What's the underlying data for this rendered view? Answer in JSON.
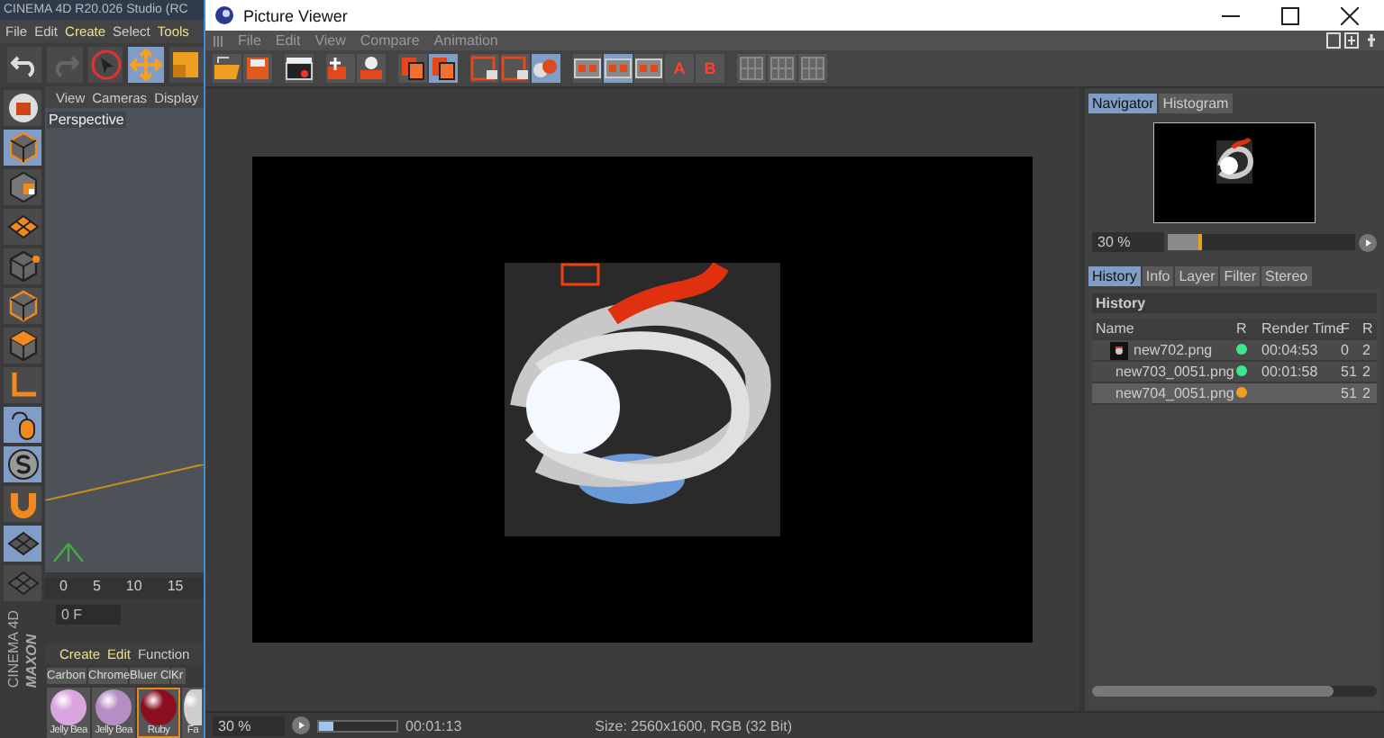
{
  "background_app": {
    "title": "CINEMA 4D R20.026 Studio (RC",
    "menu": [
      {
        "label": "File",
        "accent": false
      },
      {
        "label": "Edit",
        "accent": false
      },
      {
        "label": "Create",
        "accent": true
      },
      {
        "label": "Select",
        "accent": false
      },
      {
        "label": "Tools",
        "accent": true
      }
    ],
    "toolbar": [
      {
        "kind": "undo",
        "active": false
      },
      {
        "kind": "redo",
        "active": false
      },
      {
        "kind": "select",
        "active": false
      },
      {
        "kind": "move",
        "active": true
      },
      {
        "kind": "scale",
        "active": false
      }
    ],
    "tool_column": [
      {
        "kind": "render",
        "active": false
      },
      {
        "kind": "cube",
        "active": true
      },
      {
        "kind": "checker",
        "active": false
      },
      {
        "kind": "grid",
        "active": false
      },
      {
        "kind": "point",
        "active": false
      },
      {
        "kind": "edge",
        "active": false
      },
      {
        "kind": "face",
        "active": false
      },
      {
        "kind": "axis",
        "active": false
      },
      {
        "kind": "mouse",
        "active": true
      },
      {
        "kind": "snap",
        "active": true
      },
      {
        "kind": "magnet",
        "active": false
      },
      {
        "kind": "lock",
        "active": true
      },
      {
        "kind": "workplane",
        "active": false
      }
    ],
    "viewport_menu": [
      "View",
      "Cameras",
      "Display"
    ],
    "viewport_label": "Perspective",
    "timeline_ticks": [
      "0",
      "5",
      "10",
      "15"
    ],
    "frame_field": "0 F",
    "logo": [
      "MAXON",
      "CINEMA 4D"
    ],
    "material_menu": [
      {
        "label": "Create",
        "accent": true
      },
      {
        "label": "Edit",
        "accent": true
      },
      {
        "label": "Function",
        "accent": false
      }
    ],
    "material_labels": [
      "Carbon",
      "Chrome",
      "Bluer Cl",
      "Kr"
    ],
    "materials": [
      {
        "name": "Jelly Bea",
        "color": "#d9a6e0",
        "selected": false
      },
      {
        "name": "Jelly Bea",
        "color": "#b58fc4",
        "selected": false
      },
      {
        "name": "Ruby",
        "color": "#8a1020",
        "selected": true
      },
      {
        "name": "Fa",
        "color": "#cfcfcf",
        "selected": false
      }
    ]
  },
  "viewer": {
    "title": "Picture Viewer",
    "menu": [
      "File",
      "Edit",
      "View",
      "Compare",
      "Animation"
    ],
    "toolbar_groups": [
      [
        {
          "kind": "open",
          "active": false
        },
        {
          "kind": "save",
          "active": false
        }
      ],
      [
        {
          "kind": "clapper",
          "active": false
        }
      ],
      [
        {
          "kind": "edit",
          "active": false
        },
        {
          "kind": "person",
          "active": false
        }
      ],
      [
        {
          "kind": "layers",
          "active": false
        },
        {
          "kind": "layers",
          "active": true
        }
      ],
      [
        {
          "kind": "frame",
          "active": false
        },
        {
          "kind": "frame",
          "active": false
        },
        {
          "kind": "spheres",
          "active": true
        }
      ],
      [
        {
          "kind": "split",
          "active": false
        },
        {
          "kind": "split",
          "active": true
        },
        {
          "kind": "split",
          "active": false
        },
        {
          "kind": "letter",
          "label": "A",
          "active": false
        },
        {
          "kind": "letter",
          "label": "B",
          "active": false
        }
      ],
      [
        {
          "kind": "grid",
          "active": false
        },
        {
          "kind": "grid",
          "active": false
        },
        {
          "kind": "grid",
          "active": false
        }
      ]
    ],
    "navigator_tabs": [
      {
        "label": "Navigator",
        "selected": true
      },
      {
        "label": "Histogram",
        "selected": false
      }
    ],
    "zoom": {
      "value": "30 %",
      "level": 0.16
    },
    "history_tabs": [
      {
        "label": "History",
        "selected": true
      },
      {
        "label": "Info",
        "selected": false
      },
      {
        "label": "Layer",
        "selected": false
      },
      {
        "label": "Filter",
        "selected": false
      },
      {
        "label": "Stereo",
        "selected": false
      }
    ],
    "history_title": "History",
    "columns": [
      "Name",
      "R",
      "Render Time",
      "F",
      "R"
    ],
    "rows": [
      {
        "kind": "image",
        "name": "new702.png",
        "color": "#3ee88a",
        "render_time": "00:04:53",
        "frame": "0",
        "column_5": "2",
        "selected": false
      },
      {
        "kind": "image",
        "name": "new703_0051.png",
        "color": "#3ee88a",
        "render_time": "00:01:58",
        "frame": "51",
        "column_5": "2",
        "selected": false
      },
      {
        "kind": "pending",
        "name": "new704_0051.png",
        "color": "#f0a020",
        "frame": "51",
        "column_5": "2",
        "selected": true
      }
    ],
    "status": {
      "zoom": "30 %",
      "level": 0.18,
      "time": "00:01:13",
      "info": "Size: 2560x1600, RGB (32 Bit)"
    }
  }
}
